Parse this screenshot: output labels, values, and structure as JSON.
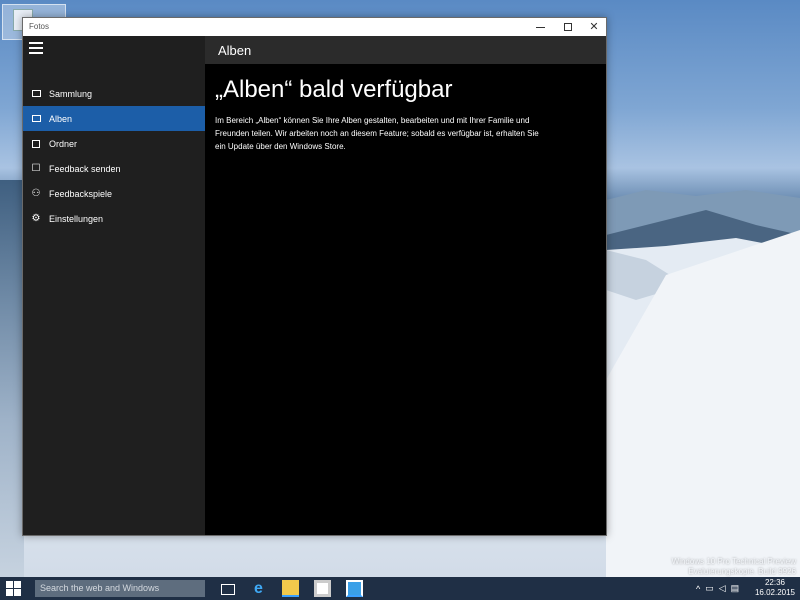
{
  "window": {
    "title": "Fotos",
    "controls": {
      "minimize": "minimize-icon",
      "maximize": "maximize-icon",
      "close": "close-icon"
    }
  },
  "sidebar": {
    "menu_icon": "hamburger-icon",
    "items": [
      {
        "label": "Sammlung",
        "icon": "collection-icon",
        "active": false
      },
      {
        "label": "Alben",
        "icon": "album-icon",
        "active": true
      },
      {
        "label": "Ordner",
        "icon": "folder-icon",
        "active": false
      },
      {
        "label": "Feedback senden",
        "icon": "feedback-icon",
        "active": false
      },
      {
        "label": "Feedbackspiele",
        "icon": "people-icon",
        "active": false
      },
      {
        "label": "Einstellungen",
        "icon": "gear-icon",
        "active": false
      }
    ]
  },
  "header": {
    "title": "Alben"
  },
  "content": {
    "heading": "„Alben“ bald verfügbar",
    "body": "Im Bereich „Alben“ können Sie Ihre Alben gestalten, bearbeiten und mit Ihrer Familie und Freunden teilen. Wir arbeiten noch an diesem Feature; sobald es verfügbar ist, erhalten Sie ein Update über den Windows Store."
  },
  "desktop": {
    "watermark_line1": "Windows 10 Pro Technical Preview",
    "watermark_line2": "Evaluierungskopie. Build 9926"
  },
  "taskbar": {
    "search_placeholder": "Search the web and Windows",
    "clock_time": "22:36",
    "clock_date": "16.02.2015"
  },
  "colors": {
    "accent": "#1c5ea8",
    "sidebar_bg": "#1f1f1f",
    "header_bg": "#2b2b2b",
    "content_bg": "#000000",
    "taskbar_bg": "#1f2f45"
  }
}
